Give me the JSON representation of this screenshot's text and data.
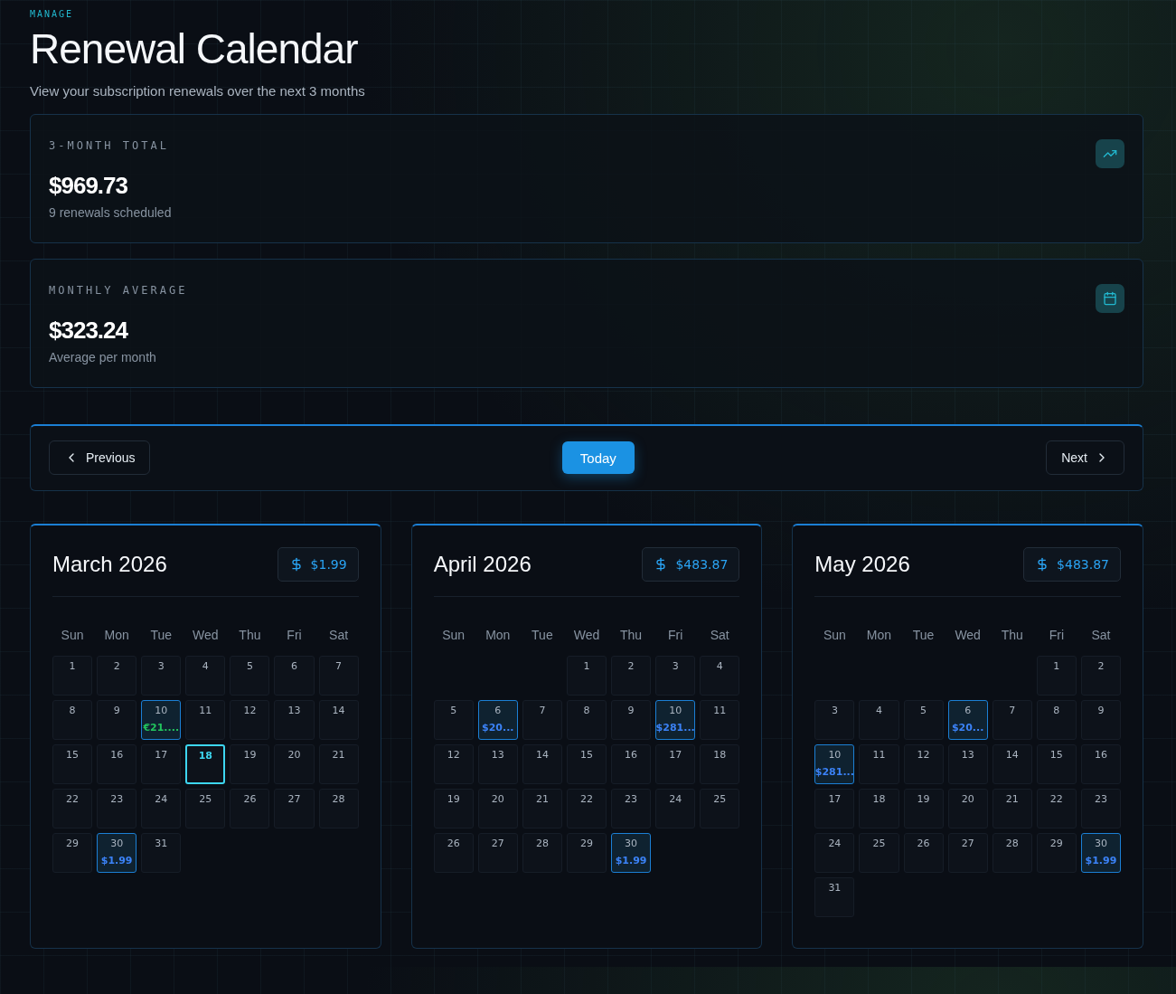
{
  "eyebrow": "MANAGE",
  "title": "Renewal Calendar",
  "subtitle": "View your subscription renewals over the next 3 months",
  "stats": [
    {
      "label": "3-MONTH TOTAL",
      "value": "$969.73",
      "note": "9 renewals scheduled"
    },
    {
      "label": "MONTHLY AVERAGE",
      "value": "$323.24",
      "note": "Average per month"
    }
  ],
  "nav": {
    "previous": "Previous",
    "today": "Today",
    "next": "Next"
  },
  "months": [
    {
      "title": "March 2026",
      "total": "$1.99",
      "weekdays": [
        "Sun",
        "Mon",
        "Tue",
        "Wed",
        "Thu",
        "Fri",
        "Sat"
      ],
      "weeks": [
        {
          "kind": "week",
          "days": [
            {
              "day": "1",
              "today": false
            },
            {
              "day": "2",
              "today": false
            },
            {
              "day": "3",
              "today": false
            },
            {
              "day": "4",
              "today": false
            },
            {
              "day": "5",
              "today": false
            },
            {
              "day": "6",
              "today": false
            },
            {
              "day": "7",
              "today": false
            }
          ]
        },
        {
          "kind": "week",
          "days": [
            {
              "day": "8",
              "today": false
            },
            {
              "day": "9",
              "today": false
            },
            {
              "day": "10",
              "today": false,
              "amount": "€21....",
              "color": "#22c55e"
            },
            {
              "day": "11",
              "today": false
            },
            {
              "day": "12",
              "today": false
            },
            {
              "day": "13",
              "today": false
            },
            {
              "day": "14",
              "today": false
            }
          ]
        },
        {
          "kind": "week",
          "days": [
            {
              "day": "15",
              "today": false
            },
            {
              "day": "16",
              "today": false
            },
            {
              "day": "17",
              "today": false
            },
            {
              "day": "18",
              "today": true
            },
            {
              "day": "19",
              "today": false
            },
            {
              "day": "20",
              "today": false
            },
            {
              "day": "21",
              "today": false
            }
          ]
        },
        {
          "kind": "week",
          "days": [
            {
              "day": "22",
              "today": false
            },
            {
              "day": "23",
              "today": false
            },
            {
              "day": "24",
              "today": false
            },
            {
              "day": "25",
              "today": false
            },
            {
              "day": "26",
              "today": false
            },
            {
              "day": "27",
              "today": false
            },
            {
              "day": "28",
              "today": false
            }
          ]
        },
        {
          "kind": "week",
          "days": [
            {
              "day": "29",
              "today": false
            },
            {
              "day": "30",
              "today": false,
              "amount": "$1.99",
              "color": "#3b82f6"
            },
            {
              "day": "31",
              "today": false
            }
          ]
        }
      ]
    },
    {
      "title": "April 2026",
      "total": "$483.87",
      "weekdays": [
        "Sun",
        "Mon",
        "Tue",
        "Wed",
        "Thu",
        "Fri",
        "Sat"
      ],
      "weeks": [
        {
          "kind": "lead",
          "days": [
            {
              "day": "1",
              "today": false
            },
            {
              "day": "2",
              "today": false
            },
            {
              "day": "3",
              "today": false
            },
            {
              "day": "4",
              "today": false
            }
          ]
        },
        {
          "kind": "week",
          "days": [
            {
              "day": "5",
              "today": false
            },
            {
              "day": "6",
              "today": false,
              "amount": "$20...",
              "color": "#3b82f6"
            },
            {
              "day": "7",
              "today": false
            },
            {
              "day": "8",
              "today": false
            },
            {
              "day": "9",
              "today": false
            },
            {
              "day": "10",
              "today": false,
              "amount": "$281...",
              "color": "#3b82f6"
            },
            {
              "day": "11",
              "today": false
            }
          ]
        },
        {
          "kind": "week",
          "days": [
            {
              "day": "12",
              "today": false
            },
            {
              "day": "13",
              "today": false
            },
            {
              "day": "14",
              "today": false
            },
            {
              "day": "15",
              "today": false
            },
            {
              "day": "16",
              "today": false
            },
            {
              "day": "17",
              "today": false
            },
            {
              "day": "18",
              "today": false
            }
          ]
        },
        {
          "kind": "week",
          "days": [
            {
              "day": "19",
              "today": false
            },
            {
              "day": "20",
              "today": false
            },
            {
              "day": "21",
              "today": false
            },
            {
              "day": "22",
              "today": false
            },
            {
              "day": "23",
              "today": false
            },
            {
              "day": "24",
              "today": false
            },
            {
              "day": "25",
              "today": false
            }
          ]
        },
        {
          "kind": "week",
          "days": [
            {
              "day": "26",
              "today": false
            },
            {
              "day": "27",
              "today": false
            },
            {
              "day": "28",
              "today": false
            },
            {
              "day": "29",
              "today": false
            },
            {
              "day": "30",
              "today": false,
              "amount": "$1.99",
              "color": "#3b82f6"
            }
          ]
        }
      ]
    },
    {
      "title": "May 2026",
      "total": "$483.87",
      "weekdays": [
        "Sun",
        "Mon",
        "Tue",
        "Wed",
        "Thu",
        "Fri",
        "Sat"
      ],
      "weeks": [
        {
          "kind": "lead",
          "days": [
            {
              "day": "1",
              "today": false
            },
            {
              "day": "2",
              "today": false
            }
          ]
        },
        {
          "kind": "week",
          "days": [
            {
              "day": "3",
              "today": false
            },
            {
              "day": "4",
              "today": false
            },
            {
              "day": "5",
              "today": false
            },
            {
              "day": "6",
              "today": false,
              "amount": "$20...",
              "color": "#3b82f6"
            },
            {
              "day": "7",
              "today": false
            },
            {
              "day": "8",
              "today": false
            },
            {
              "day": "9",
              "today": false
            }
          ]
        },
        {
          "kind": "week",
          "days": [
            {
              "day": "10",
              "today": false,
              "amount": "$281...",
              "color": "#3b82f6"
            },
            {
              "day": "11",
              "today": false
            },
            {
              "day": "12",
              "today": false
            },
            {
              "day": "13",
              "today": false
            },
            {
              "day": "14",
              "today": false
            },
            {
              "day": "15",
              "today": false
            },
            {
              "day": "16",
              "today": false
            }
          ]
        },
        {
          "kind": "week",
          "days": [
            {
              "day": "17",
              "today": false
            },
            {
              "day": "18",
              "today": false
            },
            {
              "day": "19",
              "today": false
            },
            {
              "day": "20",
              "today": false
            },
            {
              "day": "21",
              "today": false
            },
            {
              "day": "22",
              "today": false
            },
            {
              "day": "23",
              "today": false
            }
          ]
        },
        {
          "kind": "week",
          "days": [
            {
              "day": "24",
              "today": false
            },
            {
              "day": "25",
              "today": false
            },
            {
              "day": "26",
              "today": false
            },
            {
              "day": "27",
              "today": false
            },
            {
              "day": "28",
              "today": false
            },
            {
              "day": "29",
              "today": false
            },
            {
              "day": "30",
              "today": false,
              "amount": "$1.99",
              "color": "#3b82f6"
            }
          ]
        },
        {
          "kind": "week",
          "days": [
            {
              "day": "31",
              "today": false
            }
          ]
        }
      ]
    }
  ]
}
